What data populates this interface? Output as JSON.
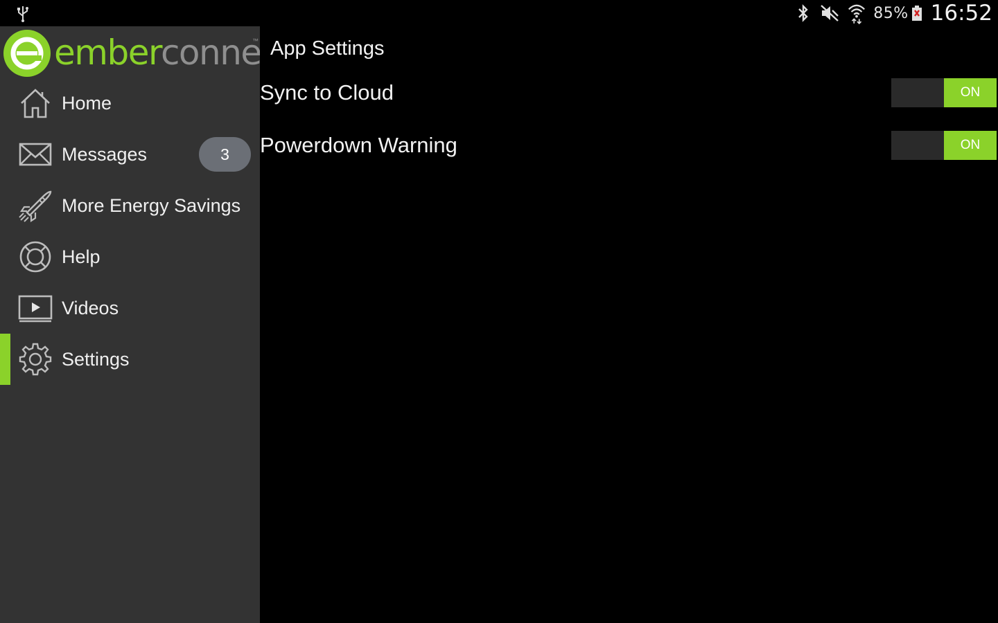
{
  "status_bar": {
    "battery_percent": "85%",
    "time": "16:52",
    "icons": [
      "usb-icon",
      "bluetooth-icon",
      "mute-icon",
      "wifi-icon",
      "battery-icon"
    ]
  },
  "app": {
    "logo_ember": "ember",
    "logo_connect": "connect",
    "logo_tm": "™",
    "accent_color": "#8bd22a"
  },
  "sidebar": {
    "items": [
      {
        "label": "Home",
        "icon": "home-icon"
      },
      {
        "label": "Messages",
        "icon": "envelope-icon",
        "badge": "3"
      },
      {
        "label": "More Energy Savings",
        "icon": "rocket-icon"
      },
      {
        "label": "Help",
        "icon": "lifebuoy-icon"
      },
      {
        "label": "Videos",
        "icon": "video-play-icon"
      },
      {
        "label": "Settings",
        "icon": "gear-icon",
        "active": true
      }
    ]
  },
  "main": {
    "title": "App Settings",
    "settings": [
      {
        "label": "Sync to Cloud",
        "toggle_text": "ON",
        "state": "on"
      },
      {
        "label": "Powerdown Warning",
        "toggle_text": "ON",
        "state": "on"
      }
    ]
  }
}
